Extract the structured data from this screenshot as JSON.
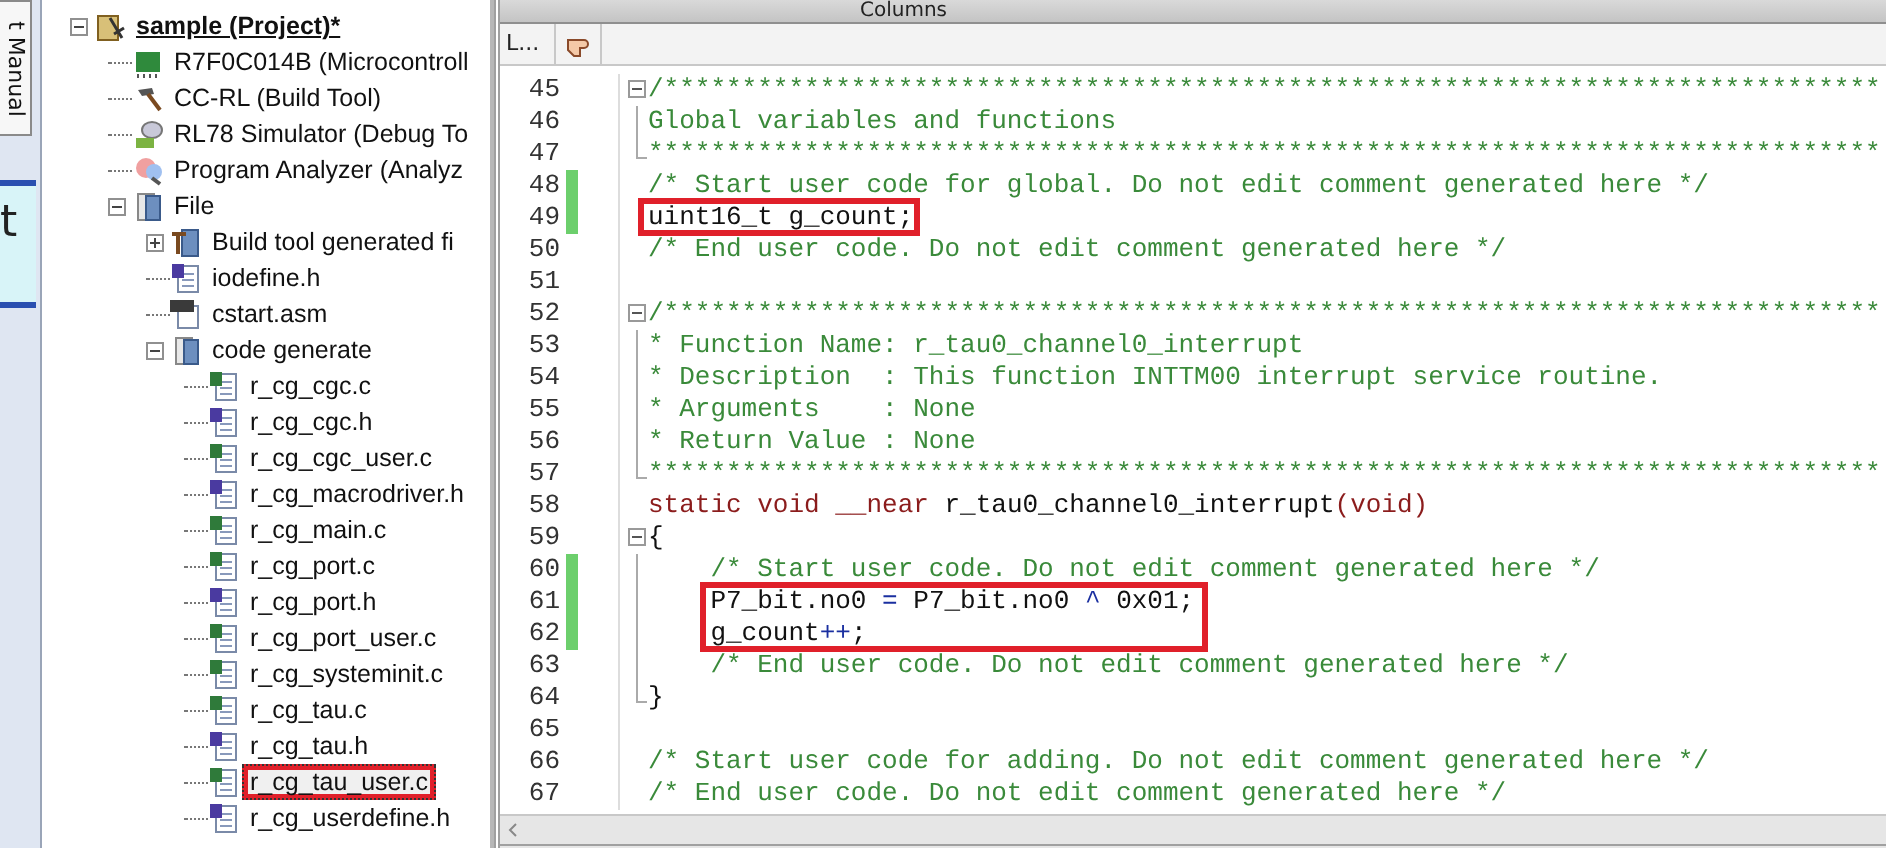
{
  "side_strip": {
    "tab_label": "t Manual",
    "letter": "t"
  },
  "toolbar": {
    "label": "Columns"
  },
  "editor_header": {
    "column_label": "L..."
  },
  "tree": [
    {
      "label": "sample (Project)*",
      "kind": "project",
      "expanded": true,
      "selected": false,
      "boxed": false,
      "children": [
        {
          "label": "R7F0C014B (Microcontroll",
          "kind": "chip",
          "selected": false,
          "boxed": false
        },
        {
          "label": "CC-RL (Build Tool)",
          "kind": "hammer",
          "selected": false,
          "boxed": false
        },
        {
          "label": "RL78 Simulator (Debug To",
          "kind": "simulator",
          "selected": false,
          "boxed": false
        },
        {
          "label": "Program Analyzer (Analyz",
          "kind": "analyzer",
          "selected": false,
          "boxed": false
        },
        {
          "label": "File",
          "kind": "folder",
          "expanded": true,
          "selected": false,
          "boxed": false,
          "children": [
            {
              "label": "Build tool generated fi",
              "kind": "buildfolder",
              "expanded": false,
              "selected": false,
              "boxed": false
            },
            {
              "label": "iodefine.h",
              "kind": "h",
              "selected": false,
              "boxed": false
            },
            {
              "label": "cstart.asm",
              "kind": "asm",
              "selected": false,
              "boxed": false
            },
            {
              "label": "code generate",
              "kind": "folder",
              "expanded": true,
              "selected": false,
              "boxed": false,
              "children": [
                {
                  "label": "r_cg_cgc.c",
                  "kind": "c",
                  "selected": false,
                  "boxed": false
                },
                {
                  "label": "r_cg_cgc.h",
                  "kind": "h",
                  "selected": false,
                  "boxed": false
                },
                {
                  "label": "r_cg_cgc_user.c",
                  "kind": "c",
                  "selected": false,
                  "boxed": false
                },
                {
                  "label": "r_cg_macrodriver.h",
                  "kind": "h",
                  "selected": false,
                  "boxed": false
                },
                {
                  "label": "r_cg_main.c",
                  "kind": "c",
                  "selected": false,
                  "boxed": false
                },
                {
                  "label": "r_cg_port.c",
                  "kind": "c",
                  "selected": false,
                  "boxed": false
                },
                {
                  "label": "r_cg_port.h",
                  "kind": "h",
                  "selected": false,
                  "boxed": false
                },
                {
                  "label": "r_cg_port_user.c",
                  "kind": "c",
                  "selected": false,
                  "boxed": false
                },
                {
                  "label": "r_cg_systeminit.c",
                  "kind": "c",
                  "selected": false,
                  "boxed": false
                },
                {
                  "label": "r_cg_tau.c",
                  "kind": "c",
                  "selected": false,
                  "boxed": false
                },
                {
                  "label": "r_cg_tau.h",
                  "kind": "h",
                  "selected": false,
                  "boxed": false
                },
                {
                  "label": "r_cg_tau_user.c",
                  "kind": "c",
                  "selected": true,
                  "boxed": true
                },
                {
                  "label": "r_cg_userdefine.h",
                  "kind": "h",
                  "selected": false,
                  "boxed": false
                }
              ]
            }
          ]
        }
      ]
    }
  ],
  "lines": [
    {
      "number": "45",
      "kind": "foldstart",
      "modified": false,
      "boxed": false,
      "segments": [
        {
          "kind": "comment",
          "text": "/******************************************************************************"
        }
      ]
    },
    {
      "number": "46",
      "kind": "foldbody",
      "modified": false,
      "boxed": false,
      "segments": [
        {
          "kind": "comment",
          "text": "Global variables and functions"
        }
      ]
    },
    {
      "number": "47",
      "kind": "foldend",
      "modified": false,
      "boxed": false,
      "segments": [
        {
          "kind": "comment",
          "text": "*******************************************************************************"
        }
      ]
    },
    {
      "number": "48",
      "kind": "plain",
      "modified": true,
      "boxed": false,
      "segments": [
        {
          "kind": "comment",
          "text": "/* Start user code for global. Do not edit comment generated here */"
        }
      ]
    },
    {
      "number": "49",
      "kind": "plain",
      "modified": true,
      "boxed": true,
      "segments": [
        {
          "kind": "plain",
          "text": "uint16_t g_count;"
        }
      ]
    },
    {
      "number": "50",
      "kind": "plain",
      "modified": false,
      "boxed": false,
      "segments": [
        {
          "kind": "comment",
          "text": "/* End user code. Do not edit comment generated here */"
        }
      ]
    },
    {
      "number": "51",
      "kind": "plain",
      "modified": false,
      "boxed": false
    },
    {
      "number": "52",
      "kind": "foldstart",
      "modified": false,
      "boxed": false,
      "segments": [
        {
          "kind": "comment",
          "text": "/******************************************************************************"
        }
      ]
    },
    {
      "number": "53",
      "kind": "foldbody",
      "modified": false,
      "boxed": false,
      "segments": [
        {
          "kind": "comment",
          "text": "* Function Name: r_tau0_channel0_interrupt"
        }
      ]
    },
    {
      "number": "54",
      "kind": "foldbody",
      "modified": false,
      "boxed": false,
      "segments": [
        {
          "kind": "comment",
          "text": "* Description  : This function INTTM00 interrupt service routine."
        }
      ]
    },
    {
      "number": "55",
      "kind": "foldbody",
      "modified": false,
      "boxed": false,
      "segments": [
        {
          "kind": "comment",
          "text": "* Arguments    : None"
        }
      ]
    },
    {
      "number": "56",
      "kind": "foldbody",
      "modified": false,
      "boxed": false,
      "segments": [
        {
          "kind": "comment",
          "text": "* Return Value : None"
        }
      ]
    },
    {
      "number": "57",
      "kind": "foldend",
      "modified": false,
      "boxed": false,
      "segments": [
        {
          "kind": "comment",
          "text": "*******************************************************************************"
        }
      ]
    },
    {
      "number": "58",
      "kind": "plain",
      "modified": false,
      "boxed": false,
      "segments": [
        {
          "kind": "keyword",
          "text": "static void __near"
        },
        {
          "kind": "plain",
          "text": " r_tau0_channel0_interrupt"
        },
        {
          "kind": "keyword",
          "text": "(void)"
        }
      ]
    },
    {
      "number": "59",
      "kind": "foldstart",
      "modified": false,
      "boxed": false,
      "segments": [
        {
          "kind": "plain",
          "text": "{"
        }
      ]
    },
    {
      "number": "60",
      "kind": "foldbody",
      "modified": true,
      "boxed": false,
      "segments": [
        {
          "kind": "comment",
          "text": "    /* Start user code. Do not edit comment generated here */"
        }
      ]
    },
    {
      "number": "61",
      "kind": "foldbody",
      "modified": true,
      "boxed": true,
      "segments": [
        {
          "kind": "plain",
          "text": "    P7_bit.no0 "
        },
        {
          "kind": "operator",
          "text": "="
        },
        {
          "kind": "plain",
          "text": " P7_bit.no0 "
        },
        {
          "kind": "operator",
          "text": "^"
        },
        {
          "kind": "plain",
          "text": " 0x01;"
        }
      ]
    },
    {
      "number": "62",
      "kind": "foldbody",
      "modified": true,
      "boxed": true,
      "segments": [
        {
          "kind": "plain",
          "text": "    g_count"
        },
        {
          "kind": "operator",
          "text": "++"
        },
        {
          "kind": "plain",
          "text": ";"
        }
      ]
    },
    {
      "number": "63",
      "kind": "foldbody",
      "modified": false,
      "boxed": false,
      "segments": [
        {
          "kind": "comment",
          "text": "    /* End user code. Do not edit comment generated here */"
        }
      ]
    },
    {
      "number": "64",
      "kind": "foldend",
      "modified": false,
      "boxed": false,
      "segments": [
        {
          "kind": "plain",
          "text": "}"
        }
      ]
    },
    {
      "number": "65",
      "kind": "plain",
      "modified": false,
      "boxed": false
    },
    {
      "number": "66",
      "kind": "plain",
      "modified": false,
      "boxed": false,
      "segments": [
        {
          "kind": "comment",
          "text": "/* Start user code for adding. Do not edit comment generated here */"
        }
      ]
    },
    {
      "number": "67",
      "kind": "plain",
      "modified": false,
      "boxed": false,
      "segments": [
        {
          "kind": "comment",
          "text": "/* End user code. Do not edit comment generated here */"
        }
      ]
    }
  ]
}
